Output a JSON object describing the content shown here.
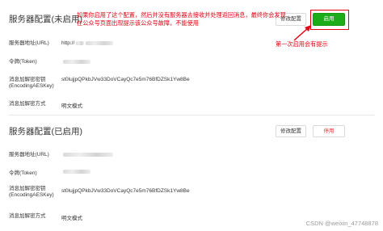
{
  "section1": {
    "title": "服务器配置(未启用)",
    "modify_label": "修改配置",
    "action_label": "启用",
    "rows": [
      {
        "label": "服务器地址(URL)",
        "value": "http://"
      },
      {
        "label": "令牌(Token)",
        "value": ""
      },
      {
        "label": "消息加解密密钥",
        "label2": "(EncodingAESKey)",
        "value": "st0lujjpQPkbJVw33DoVCayQc7e5m76BfDZSk1Yw8Be"
      },
      {
        "label": "消息加解密方式",
        "value": "明文模式"
      }
    ]
  },
  "section2": {
    "title": "服务器配置(已启用)",
    "modify_label": "修改配置",
    "action_label": "停用",
    "rows": [
      {
        "label": "服务器地址(URL)",
        "value": ""
      },
      {
        "label": "令牌(Token)",
        "value": ""
      },
      {
        "label": "消息加解密密钥",
        "label2": "(EncodingAESKey)",
        "value": "st0lujjpQPkbJVw33DoVCayQc7e5m76BfDZSk1Yw8Be"
      },
      {
        "label": "消息加解密方式",
        "value": "明文模式"
      }
    ]
  },
  "annotation": {
    "text": "如果你启用了这个配置，然后并没有服务器去接收并处理返回消息，最终你会发现在公众号页面出现提示该公众号故障，不能使用",
    "note": "第一次启用会有提示",
    "color": "#e60012"
  },
  "watermark": "CSDN @weixin_47748878",
  "colors": {
    "enable_green": "#1aad19",
    "disable_red": "#e64340"
  }
}
